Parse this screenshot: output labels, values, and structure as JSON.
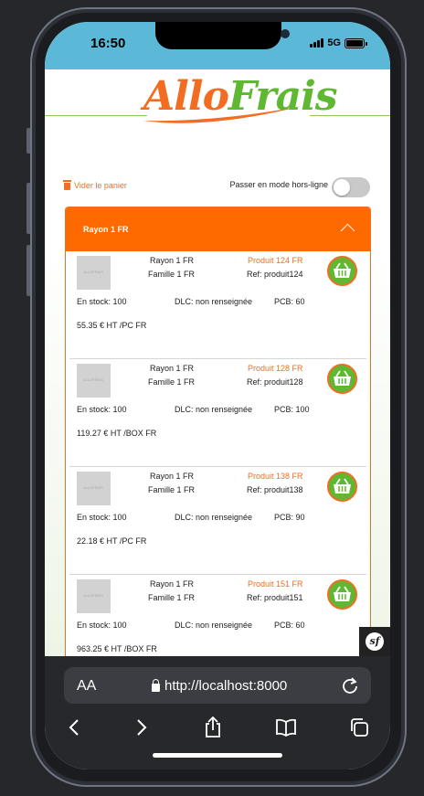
{
  "status_bar": {
    "time": "16:50",
    "network": "5G"
  },
  "logo": {
    "part1": "Allo",
    "part2": "Frais"
  },
  "toolbar": {
    "clear_cart": "Vider le panier",
    "offline_label": "Passer en mode hors-ligne"
  },
  "section": {
    "title": "Rayon 1 FR",
    "products": [
      {
        "rayon": "Rayon 1 FR",
        "famille": "Famille 1 FR",
        "name": "Produit 124 FR",
        "ref": "Ref: produit124",
        "stock": "En stock: 100",
        "dlc": "DLC: non renseignée",
        "pcb": "PCB: 60",
        "price": "55.35 € HT /PC FR"
      },
      {
        "rayon": "Rayon 1 FR",
        "famille": "Famille 1 FR",
        "name": "Produit 128 FR",
        "ref": "Ref: produit128",
        "stock": "En stock: 100",
        "dlc": "DLC: non renseignée",
        "pcb": "PCB: 100",
        "price": "119.27 € HT /BOX FR"
      },
      {
        "rayon": "Rayon 1 FR",
        "famille": "Famille 1 FR",
        "name": "Produit 138 FR",
        "ref": "Ref: produit138",
        "stock": "En stock: 100",
        "dlc": "DLC: non renseignée",
        "pcb": "PCB: 90",
        "price": "22.18 € HT /PC FR"
      },
      {
        "rayon": "Rayon 1 FR",
        "famille": "Famille 1 FR",
        "name": "Produit 151 FR",
        "ref": "Ref: produit151",
        "stock": "En stock: 100",
        "dlc": "DLC: non renseignée",
        "pcb": "PCB: 60",
        "price": "963.25 € HT /BOX FR"
      }
    ]
  },
  "browser": {
    "text_size": "AA",
    "url": "http://localhost:8000"
  },
  "colors": {
    "accent_orange": "#ff6a00",
    "brand_green": "#5fb832",
    "status_bar_blue": "#5bb8d6"
  }
}
